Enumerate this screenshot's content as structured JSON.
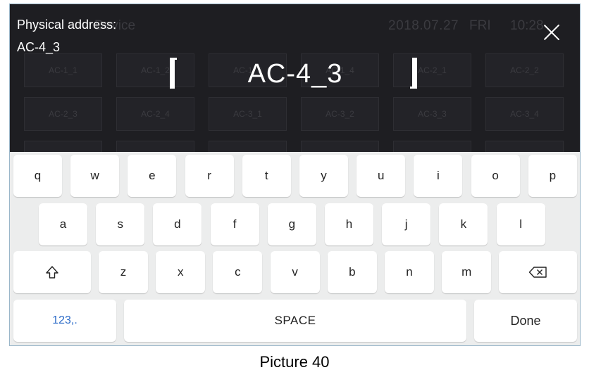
{
  "background": {
    "title": "Device",
    "date": "2018.07.27",
    "day": "FRI",
    "time": "10:28",
    "grid": [
      [
        "AC-1_1",
        "AC-1_2",
        "AC-1_3",
        "AC-1_4",
        "AC-2_1",
        "AC-2_2"
      ],
      [
        "AC-2_3",
        "AC-2_4",
        "AC-3_1",
        "AC-3_2",
        "AC-3_3",
        "AC-3_4"
      ],
      [
        "",
        "",
        "",
        "",
        "",
        ""
      ]
    ]
  },
  "overlay": {
    "address_label": "Physical address:",
    "address_value": "AC-4_3",
    "input_value": "AC-4_3"
  },
  "keyboard": {
    "row1": [
      "q",
      "w",
      "e",
      "r",
      "t",
      "y",
      "u",
      "i",
      "o",
      "p"
    ],
    "row2": [
      "a",
      "s",
      "d",
      "f",
      "g",
      "h",
      "j",
      "k",
      "l"
    ],
    "row3": [
      "z",
      "x",
      "c",
      "v",
      "b",
      "n",
      "m"
    ],
    "numbers_label": "123,.",
    "space_label": "SPACE",
    "done_label": "Done",
    "number_key_color": "#2b6ac7"
  },
  "icons": {
    "close": "close-icon",
    "shift": "shift-icon",
    "backspace": "backspace-icon"
  },
  "caption": "Picture 40"
}
